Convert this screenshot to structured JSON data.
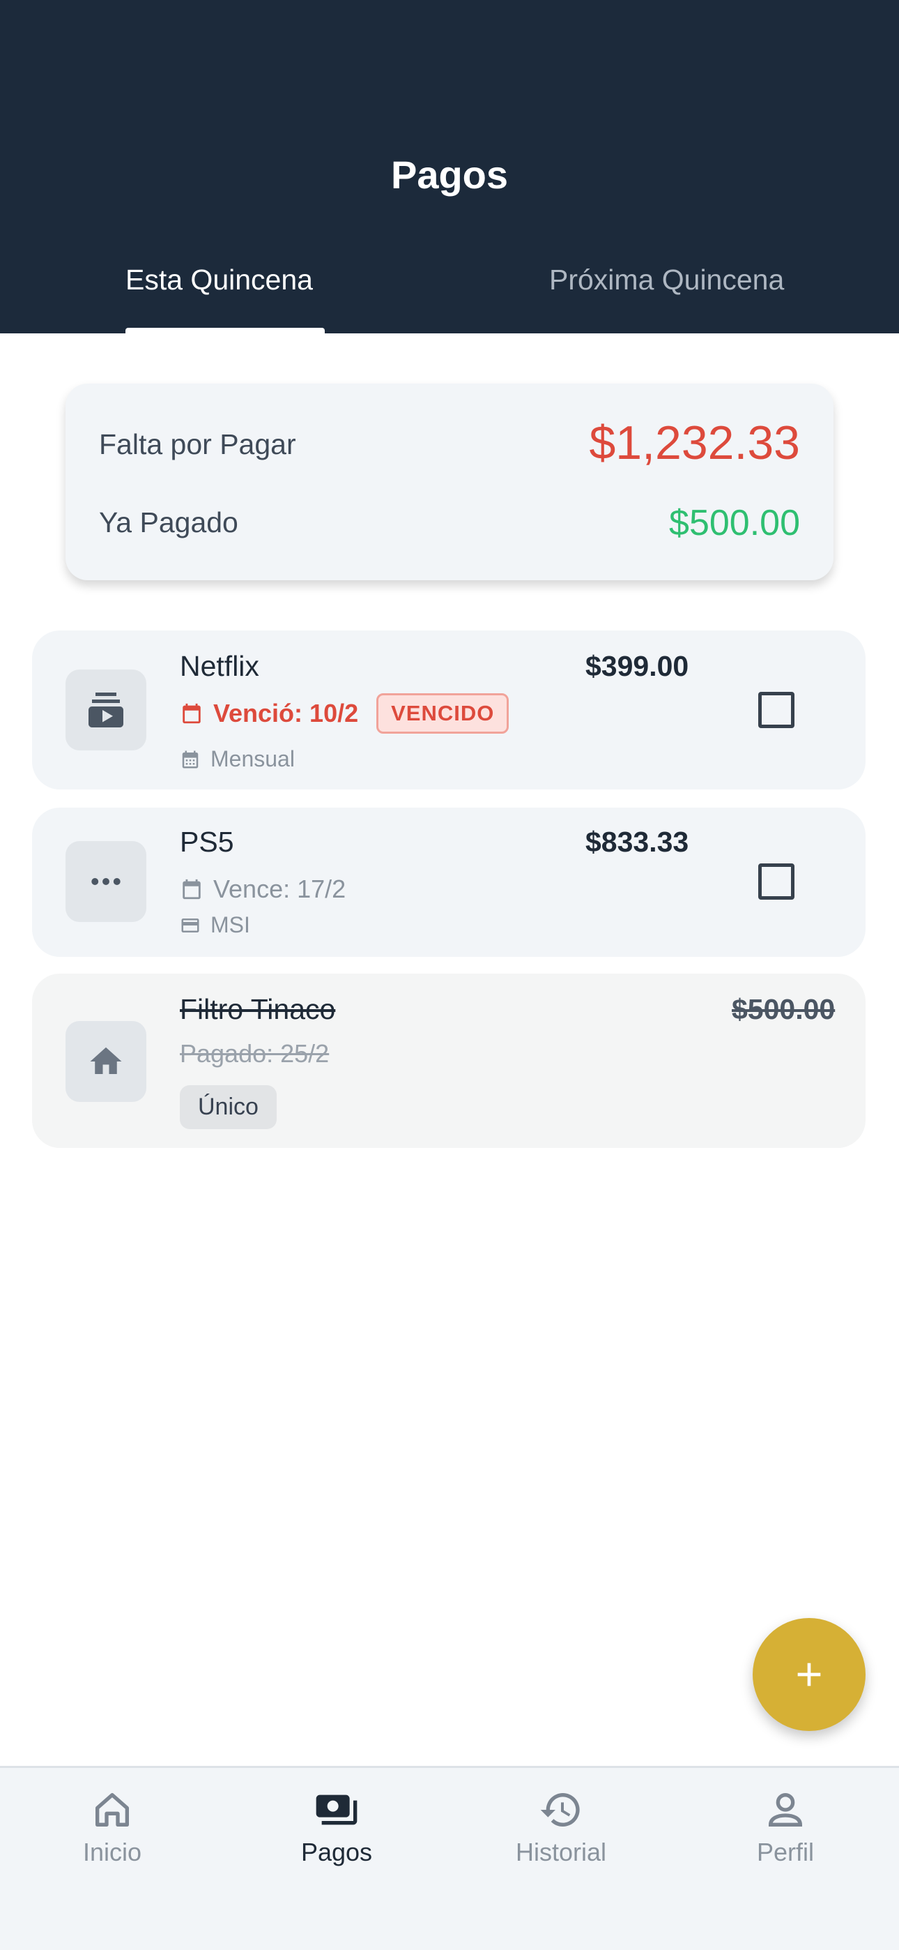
{
  "header": {
    "title": "Pagos",
    "tabs": [
      {
        "label": "Esta Quincena",
        "active": true
      },
      {
        "label": "Próxima Quincena",
        "active": false
      }
    ]
  },
  "summary": {
    "due_label": "Falta por Pagar",
    "due_value": "$1,232.33",
    "paid_label": "Ya Pagado",
    "paid_value": "$500.00"
  },
  "payments": [
    {
      "name": "Netflix",
      "amount": "$399.00",
      "date": "Venció: 10/2",
      "badge": "VENCIDO",
      "frequency": "Mensual",
      "icon": "subscriptions-icon",
      "checked": false
    },
    {
      "name": "PS5",
      "amount": "$833.33",
      "date": "Vence: 17/2",
      "frequency": "MSI",
      "icon": "more-horizontal-icon",
      "checked": false
    },
    {
      "name": "Filtro Tinaco",
      "amount": "$500.00",
      "date": "Pagado: 25/2",
      "frequency": "Único",
      "icon": "home-icon",
      "paid": true
    }
  ],
  "fab": {
    "icon": "plus-icon"
  },
  "nav": [
    {
      "label": "Inicio",
      "icon": "home-outline-icon",
      "active": false
    },
    {
      "label": "Pagos",
      "icon": "payments-icon",
      "active": true
    },
    {
      "label": "Historial",
      "icon": "history-icon",
      "active": false
    },
    {
      "label": "Perfil",
      "icon": "person-icon",
      "active": false
    }
  ],
  "colors": {
    "header_bg": "#1c2a3b",
    "danger": "#dd4a3c",
    "success": "#2fbf71",
    "accent": "#d6b035"
  }
}
